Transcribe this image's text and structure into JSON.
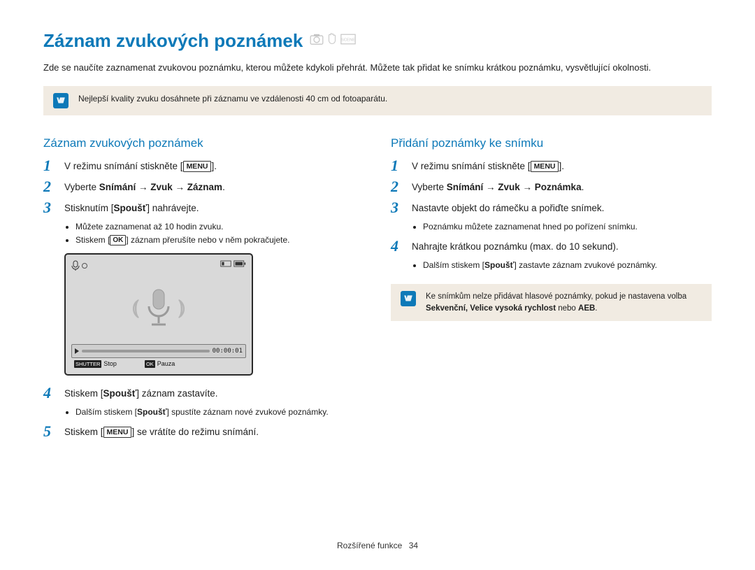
{
  "page_title": "Záznam zvukových poznámek",
  "title_icons": [
    "camera-icon",
    "hand-icon",
    "scene-icon"
  ],
  "intro": "Zde se naučíte zaznamenat zvukovou poznámku, kterou můžete kdykoli přehrát. Můžete tak přidat ke snímku krátkou poznámku, vysvětlující okolnosti.",
  "top_tip": "Nejlepší kvality zvuku dosáhnete při záznamu ve vzdálenosti 40 cm od fotoaparátu.",
  "left": {
    "heading": "Záznam zvukových poznámek",
    "steps": {
      "s1_pre": "V režimu snímání stiskněte [",
      "s1_btn": "MENU",
      "s1_post": "].",
      "s2_pre": "Vyberte ",
      "s2_bold": "Snímání → Zvuk → Záznam",
      "s2_post": ".",
      "s3_pre": "Stisknutím [",
      "s3_bold": "Spoušť",
      "s3_post": "] nahrávejte.",
      "s3_b1": "Můžete zaznamenat až 10 hodin zvuku.",
      "s3_b2_pre": "Stiskem [",
      "s3_b2_ok": "OK",
      "s3_b2_post": "] záznam přerušíte nebo v něm pokračujete.",
      "s4_pre": "Stiskem [",
      "s4_bold": "Spoušť",
      "s4_post": "] záznam zastavíte.",
      "s4_b1_pre": "Dalším stiskem [",
      "s4_b1_bold": "Spoušť",
      "s4_b1_post": "] spustíte záznam nové zvukové poznámky.",
      "s5_pre": "Stiskem [",
      "s5_btn": "MENU",
      "s5_post": "] se vrátíte do režimu snímání."
    },
    "figure": {
      "time": "00:00:01",
      "shutter_label": "SHUTTER",
      "shutter_text": "Stop",
      "ok_label": "OK",
      "ok_text": "Pauza"
    }
  },
  "right": {
    "heading": "Přidání poznámky ke snímku",
    "steps": {
      "s1_pre": "V režimu snímání stiskněte [",
      "s1_btn": "MENU",
      "s1_post": "].",
      "s2_pre": "Vyberte ",
      "s2_bold": "Snímání → Zvuk → Poznámka",
      "s2_post": ".",
      "s3": "Nastavte objekt do rámečku a pořiďte snímek.",
      "s3_b1": "Poznámku můžete zaznamenat hned po pořízení snímku.",
      "s4": "Nahrajte krátkou poznámku (max. do 10 sekund).",
      "s4_b1_pre": "Dalším stiskem [",
      "s4_b1_bold": "Spoušť",
      "s4_b1_post": "] zastavte záznam zvukové poznámky."
    },
    "tip_pre": "Ke snímkům nelze přidávat hlasové poznámky, pokud je nastavena volba ",
    "tip_bold": "Sekvenční, Velice vysoká rychlost",
    "tip_mid": " nebo ",
    "tip_bold2": "AEB",
    "tip_post": "."
  },
  "footer": {
    "section": "Rozšířené funkce",
    "page": "34"
  }
}
